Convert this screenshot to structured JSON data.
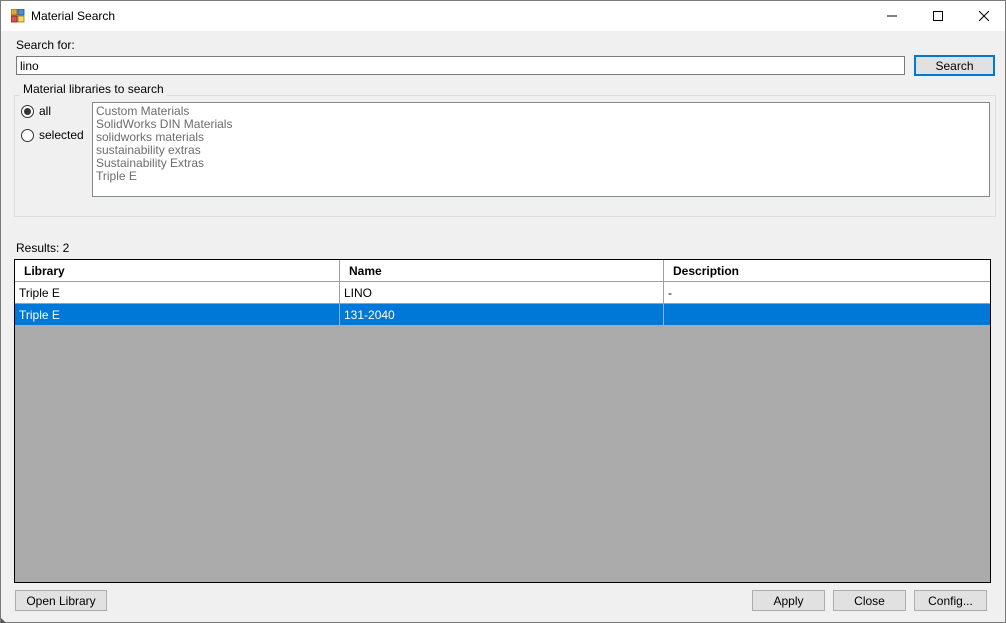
{
  "window": {
    "title": "Material Search",
    "controls": [
      "minimize-icon",
      "maximize-icon",
      "close-icon"
    ]
  },
  "search": {
    "label": "Search for:",
    "value": "lino",
    "button_label": "Search"
  },
  "libraries": {
    "group_title": "Material libraries to search",
    "options": [
      {
        "label": "all",
        "checked": true
      },
      {
        "label": "selected",
        "checked": false
      }
    ],
    "items": [
      "Custom Materials",
      "SolidWorks DIN Materials",
      "solidworks materials",
      "sustainability extras",
      "Sustainability Extras",
      "Triple E"
    ]
  },
  "results": {
    "label": "Results: 2",
    "columns": [
      "Library",
      "Name",
      "Description"
    ],
    "rows": [
      {
        "library": "Triple E",
        "name": "LINO",
        "description": "-",
        "selected": false
      },
      {
        "library": "Triple E",
        "name": "131-2040",
        "description": "",
        "selected": true
      }
    ]
  },
  "footer": {
    "open_library": "Open Library",
    "apply": "Apply",
    "close": "Close",
    "config": "Config..."
  },
  "colors": {
    "selection": "#0078d7",
    "grid_background": "#ababab"
  }
}
